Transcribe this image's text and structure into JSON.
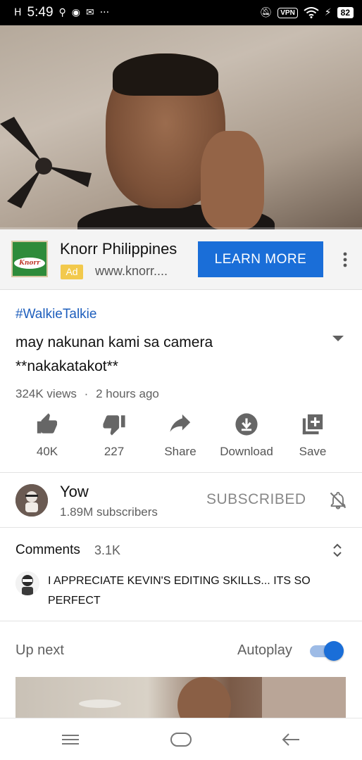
{
  "status_bar": {
    "network": "H",
    "time": "5:49",
    "vpn": "VPN",
    "battery": "82"
  },
  "ad": {
    "advertiser": "Knorr Philippines",
    "logo_text": "Knorr",
    "badge": "Ad",
    "url": "www.knorr....",
    "cta": "LEARN MORE"
  },
  "video": {
    "hashtag": "#WalkieTalkie",
    "title": "may nakunan kami sa camera **nakakatakot**",
    "views": "324K views",
    "separator": "·",
    "time_ago": "2 hours ago"
  },
  "actions": {
    "like": "40K",
    "dislike": "227",
    "share": "Share",
    "download": "Download",
    "save": "Save"
  },
  "channel": {
    "name": "Yow",
    "subscribers": "1.89M subscribers",
    "subscribe_state": "SUBSCRIBED"
  },
  "comments": {
    "label": "Comments",
    "count": "3.1K",
    "top_comment": "I APPRECIATE KEVIN'S EDITING SKILLS... ITS SO PERFECT"
  },
  "up_next": {
    "label": "Up next",
    "autoplay_label": "Autoplay",
    "autoplay_on": true
  },
  "colors": {
    "accent": "#1a6ed8",
    "hashtag": "#1f5fbd",
    "ad_badge": "#f2c94c"
  }
}
